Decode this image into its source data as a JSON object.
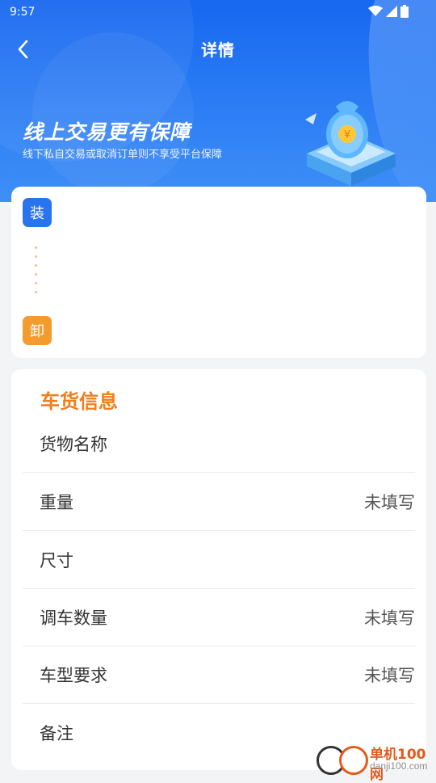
{
  "status_bar": {
    "time": "9:57",
    "icons": [
      "wifi-icon",
      "signal-icon",
      "battery-icon"
    ]
  },
  "header": {
    "title": "详情",
    "back_icon": "chevron-left-icon"
  },
  "banner": {
    "title": "线上交易更有保障",
    "subtitle": "线下私自交易或取消订单则不享受平台保障"
  },
  "route": {
    "load_label": "装",
    "unload_label": "卸"
  },
  "cargo_info": {
    "section_title": "车货信息",
    "rows": [
      {
        "label": "货物名称",
        "value": ""
      },
      {
        "label": "重量",
        "value": "未填写"
      },
      {
        "label": "尺寸",
        "value": ""
      },
      {
        "label": "调车数量",
        "value": "未填写"
      },
      {
        "label": "车型要求",
        "value": "未填写"
      },
      {
        "label": "备注",
        "value": ""
      }
    ]
  },
  "watermark": {
    "name": "单机100网",
    "url": "danji100.com"
  },
  "colors": {
    "header_blue": "#1767f0",
    "load_badge": "#2a73ef",
    "unload_badge": "#f49b2e",
    "section_orange": "#f07e1c"
  }
}
